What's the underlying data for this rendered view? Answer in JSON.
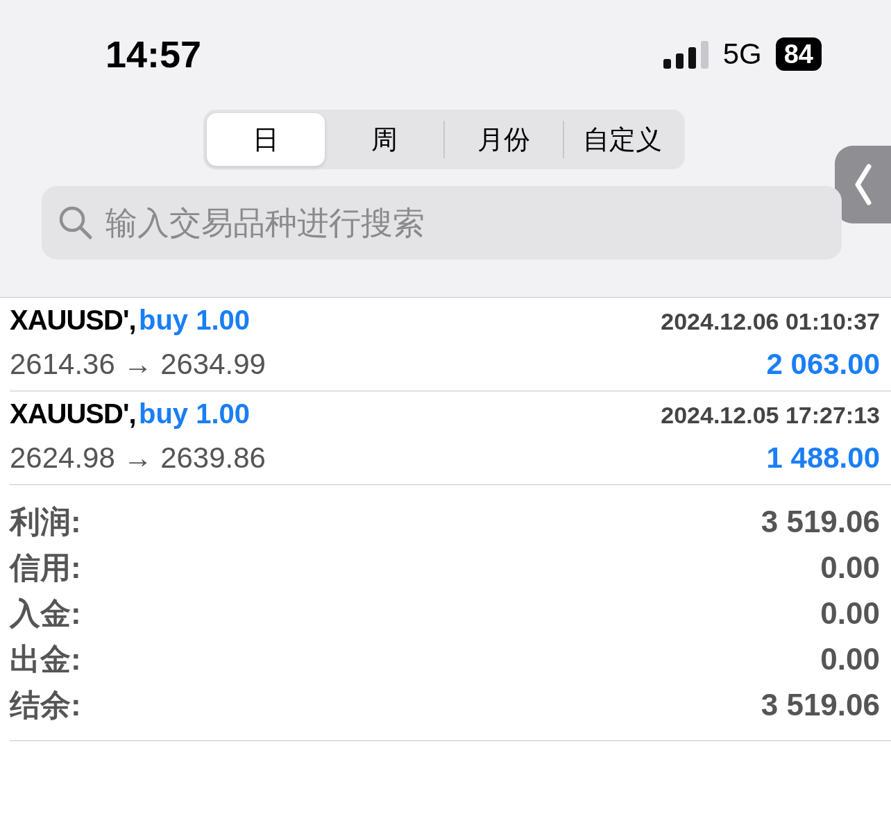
{
  "status_bar": {
    "time": "14:57",
    "network": "5G",
    "battery": "84"
  },
  "period_tabs": [
    {
      "label": "日",
      "selected": true
    },
    {
      "label": "周",
      "selected": false
    },
    {
      "label": "月份",
      "selected": false
    },
    {
      "label": "自定义",
      "selected": false
    }
  ],
  "search": {
    "placeholder": "输入交易品种进行搜索"
  },
  "deals": [
    {
      "symbol": "XAUUSD',",
      "side": "buy 1.00",
      "time": "2024.12.06 01:10:37",
      "prices": "2614.36 → 2634.99",
      "profit": "2 063.00"
    },
    {
      "symbol": "XAUUSD',",
      "side": "buy 1.00",
      "time": "2024.12.05 17:27:13",
      "prices": "2624.98 → 2639.86",
      "profit": "1 488.00"
    }
  ],
  "summary": [
    {
      "label": "利润:",
      "value": "3 519.06"
    },
    {
      "label": "信用:",
      "value": "0.00"
    },
    {
      "label": "入金:",
      "value": "0.00"
    },
    {
      "label": "出金:",
      "value": "0.00"
    },
    {
      "label": "结余:",
      "value": "3 519.06"
    }
  ]
}
